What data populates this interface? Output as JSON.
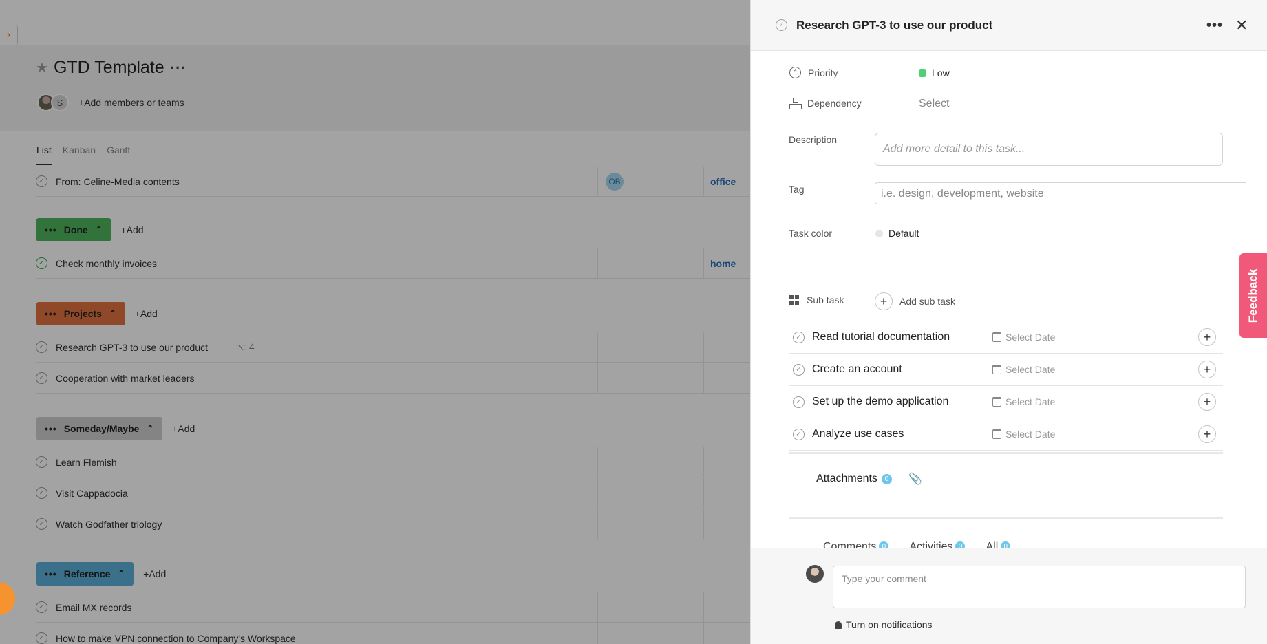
{
  "project": {
    "title": "GTD Template",
    "add_members_label": "Add members or teams",
    "member_initial": "S"
  },
  "view_tabs": [
    "List",
    "Kanban",
    "Gantt"
  ],
  "rows_top": [
    {
      "name": "From: Celine-Media contents",
      "assignee": "OB",
      "tag": "office"
    }
  ],
  "sections": [
    {
      "name": "Done",
      "color": "#4fb55d",
      "add_label": "Add",
      "rows": [
        {
          "name": "Check monthly invoices",
          "tag": "home",
          "done": true
        }
      ]
    },
    {
      "name": "Projects",
      "color": "#e0733f",
      "add_label": "Add",
      "rows": [
        {
          "name": "Research GPT-3 to use our product",
          "subtasks": "4"
        },
        {
          "name": "Cooperation with market leaders"
        }
      ]
    },
    {
      "name": "Someday/Maybe",
      "color": "#cfcfcf",
      "add_label": "Add",
      "rows": [
        {
          "name": "Learn Flemish"
        },
        {
          "name": "Visit Cappadocia"
        },
        {
          "name": "Watch Godfather triology"
        }
      ]
    },
    {
      "name": "Reference",
      "color": "#5cb0d6",
      "add_label": "Add",
      "rows": [
        {
          "name": "Email MX records"
        },
        {
          "name": "How to make VPN connection to Company's Workspace"
        }
      ]
    }
  ],
  "task_panel": {
    "title": "Research GPT-3 to use our product",
    "priority_label": "Priority",
    "priority_value": "Low",
    "priority_color": "#4fd073",
    "dependency_label": "Dependency",
    "dependency_value": "Select",
    "description_label": "Description",
    "description_placeholder": "Add more detail to this task...",
    "tag_label": "Tag",
    "tag_placeholder": "i.e. design, development, website",
    "task_color_label": "Task color",
    "task_color_value": "Default",
    "subtask_label": "Sub task",
    "add_subtask_label": "Add sub task",
    "subtasks": [
      {
        "name": "Read tutorial documentation",
        "date": "Select Date"
      },
      {
        "name": "Create an account",
        "date": "Select Date"
      },
      {
        "name": "Set up the demo application",
        "date": "Select Date"
      },
      {
        "name": "Analyze use cases",
        "date": "Select Date"
      }
    ],
    "attachments_label": "Attachments",
    "attachments_count": "0",
    "activity_tabs": [
      {
        "label": "Comments",
        "count": "0"
      },
      {
        "label": "Activities",
        "count": "0"
      },
      {
        "label": "All",
        "count": "0"
      }
    ],
    "comment_placeholder": "Type your comment",
    "notifications_label": "Turn on notifications"
  },
  "feedback_label": "Feedback"
}
